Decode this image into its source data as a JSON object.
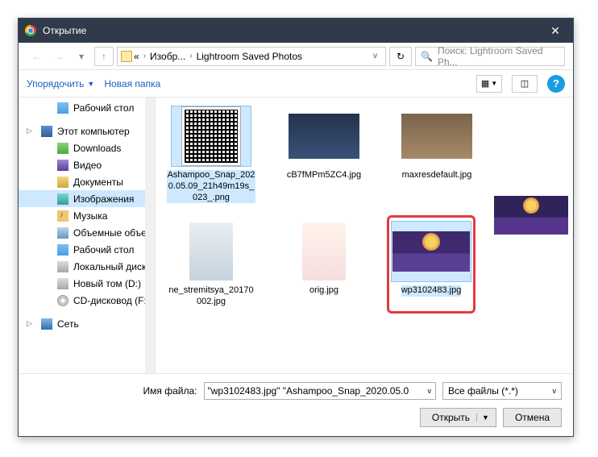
{
  "window": {
    "title": "Открытие"
  },
  "nav": {
    "breadcrumb": {
      "ellipsis": "«",
      "part1": "Изобр...",
      "part2": "Lightroom Saved Photos"
    },
    "search": {
      "placeholder": "Поиск: Lightroom Saved Ph..."
    }
  },
  "toolbar": {
    "organize": "Упорядочить",
    "newFolder": "Новая папка"
  },
  "sidebar": {
    "items": [
      {
        "label": "Рабочий стол",
        "icon": "icon-desktop"
      },
      {
        "label": "Этот компьютер",
        "icon": "icon-pc",
        "top": true
      },
      {
        "label": "Downloads",
        "icon": "icon-dl"
      },
      {
        "label": "Видео",
        "icon": "icon-video"
      },
      {
        "label": "Документы",
        "icon": "icon-doc"
      },
      {
        "label": "Изображения",
        "icon": "icon-img",
        "selected": true
      },
      {
        "label": "Музыка",
        "icon": "icon-note"
      },
      {
        "label": "Объемные объек",
        "icon": "icon-vol"
      },
      {
        "label": "Рабочий стол",
        "icon": "icon-desktop"
      },
      {
        "label": "Локальный диск",
        "icon": "icon-disk"
      },
      {
        "label": "Новый том (D:)",
        "icon": "icon-disk"
      },
      {
        "label": "CD-дисковод (F:",
        "icon": "icon-cd"
      },
      {
        "label": "Сеть",
        "icon": "icon-net",
        "top": true
      }
    ]
  },
  "files": [
    {
      "name": "Ashampoo_Snap_2020.05.09_21h49m19s_023_.png",
      "thumb": "thumb-qr",
      "sel": true
    },
    {
      "name": "cB7fMPm5ZC4.jpg",
      "thumb": "thumb-blue"
    },
    {
      "name": "maxresdefault.jpg",
      "thumb": "thumb-sepia"
    },
    {
      "name": "ne_stremitsya_20170002.jpg",
      "thumb": "thumb-man"
    },
    {
      "name": "orig.jpg",
      "thumb": "thumb-girl"
    },
    {
      "name": "wp3102483.jpg",
      "thumb": "thumb-city",
      "sel": true,
      "highlight": true
    }
  ],
  "footer": {
    "filenameLabel": "Имя файла:",
    "filenameValue": "\"wp3102483.jpg\" \"Ashampoo_Snap_2020.05.0",
    "filter": "Все файлы (*.*)",
    "open": "Открыть",
    "cancel": "Отмена"
  }
}
